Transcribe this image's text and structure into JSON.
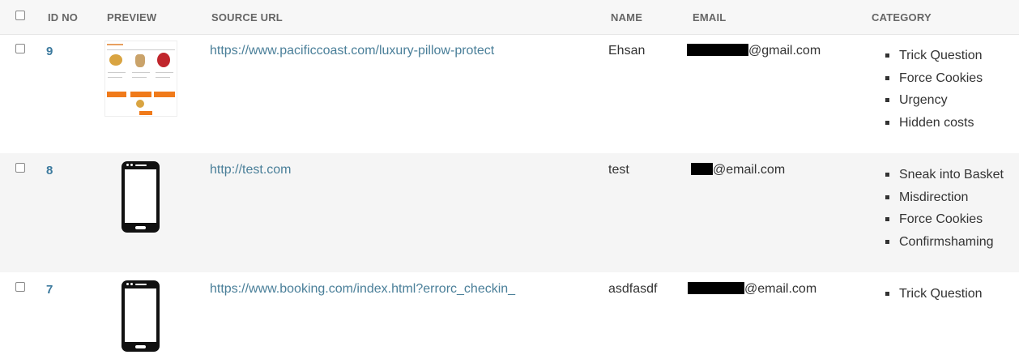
{
  "table": {
    "headers": {
      "id": "ID NO",
      "preview": "PREVIEW",
      "source_url": "SOURCE URL",
      "name": "NAME",
      "email": "EMAIL",
      "category": "CATEGORY"
    },
    "rows": [
      {
        "id": "9",
        "preview": "product-screenshot",
        "url": "https://www.pacificcoast.com/luxury-pillow-protect",
        "name": "Ehsan",
        "email_domain": "@gmail.com",
        "categories": [
          "Trick Question",
          "Force Cookies",
          "Urgency",
          "Hidden costs"
        ]
      },
      {
        "id": "8",
        "preview": "phone-icon",
        "url": "http://test.com",
        "name": "test",
        "email_domain": "@email.com",
        "categories": [
          "Sneak into Basket",
          "Misdirection",
          "Force Cookies",
          "Confirmshaming"
        ]
      },
      {
        "id": "7",
        "preview": "phone-icon",
        "url": "https://www.booking.com/index.html?errorc_checkin_",
        "name": "asdfasdf",
        "email_domain": "@email.com",
        "categories": [
          "Trick Question"
        ]
      }
    ]
  },
  "colors": {
    "link": "#4a7f99",
    "id": "#3c7a9e",
    "header_bg": "#f7f7f7",
    "alt_row_bg": "#f5f5f5"
  }
}
